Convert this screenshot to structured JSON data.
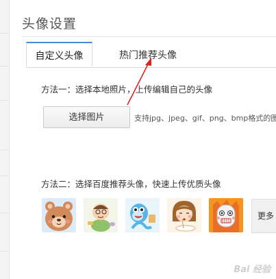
{
  "panel": {
    "title": "头像设置"
  },
  "tabs": [
    {
      "label": "自定义头像",
      "active": true
    },
    {
      "label": "热门推荐头像",
      "active": false
    }
  ],
  "method1": {
    "text": "方法一：选择本地照片，上传编辑自己的头像",
    "button_label": "选择图片",
    "formats_text": "支持jpg、jpeg、gif、png、bmp格式的图"
  },
  "method2": {
    "text": "方法二：选择百度推荐头像，快速上传优质头像",
    "avatars": [
      "bear-avatar",
      "boy-avatar",
      "blue-creature-avatar",
      "girl-avatar",
      "robot-avatar"
    ],
    "more_label": "更多"
  },
  "watermark": "Bai 经验",
  "colors": {
    "accent": "#4a8bd6",
    "annotation": "#e02020"
  }
}
